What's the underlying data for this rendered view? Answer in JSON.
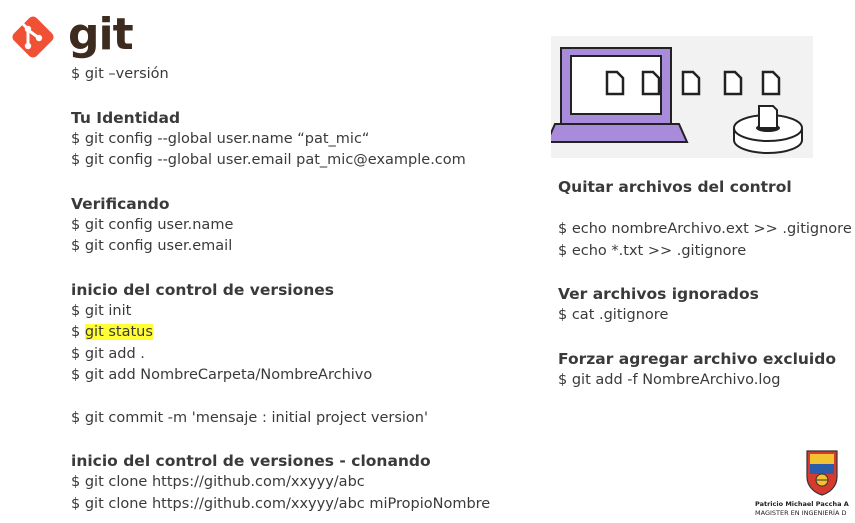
{
  "brand": {
    "wordmark": "git",
    "logo_icon": "git-diamond-icon",
    "color": "#f05033"
  },
  "left": {
    "version_cmd": "$ git –versión",
    "identity": {
      "heading": "Tu Identidad",
      "lines": [
        "$ git config --global user.name “pat_mic“",
        "$ git config --global user.email pat_mic@example.com"
      ]
    },
    "verify": {
      "heading": "Verificando",
      "lines": [
        "$ git config  user.name",
        "$ git config  user.email"
      ]
    },
    "init": {
      "heading": "inicio del control de versiones",
      "line_init": "$ git init",
      "status_prefix": "$ ",
      "status_highlight": "git status",
      "line_add": "$ git add .",
      "line_add_file": "$ git add NombreCarpeta/NombreArchivo",
      "line_commit": "$ git commit -m 'mensaje : initial project version'"
    },
    "clone": {
      "heading": "inicio del control de versiones - clonando",
      "lines": [
        "$ git clone https://github.com/xxyyy/abc",
        "$ git clone https://github.com/xxyyy/abc miPropioNombre"
      ]
    }
  },
  "right": {
    "remove": {
      "heading": "Quitar archivos del control",
      "lines": [
        "$ echo nombreArchivo.ext >> .gitignore",
        "$ echo *.txt >> .gitignore"
      ]
    },
    "ignored": {
      "heading": "Ver archivos ignorados",
      "lines": [
        "$ cat .gitignore"
      ]
    },
    "force": {
      "heading": "Forzar agregar archivo excluido",
      "lines": [
        "$ git add -f NombreArchivo.log"
      ]
    }
  },
  "credit": {
    "name": "Patricio Michael Paccha A",
    "title": "MAGISTER EN INGENIERÍA D"
  },
  "colors": {
    "highlight": "#ffff33",
    "laptop": "#a98bdc",
    "text": "#3a3a3a"
  }
}
